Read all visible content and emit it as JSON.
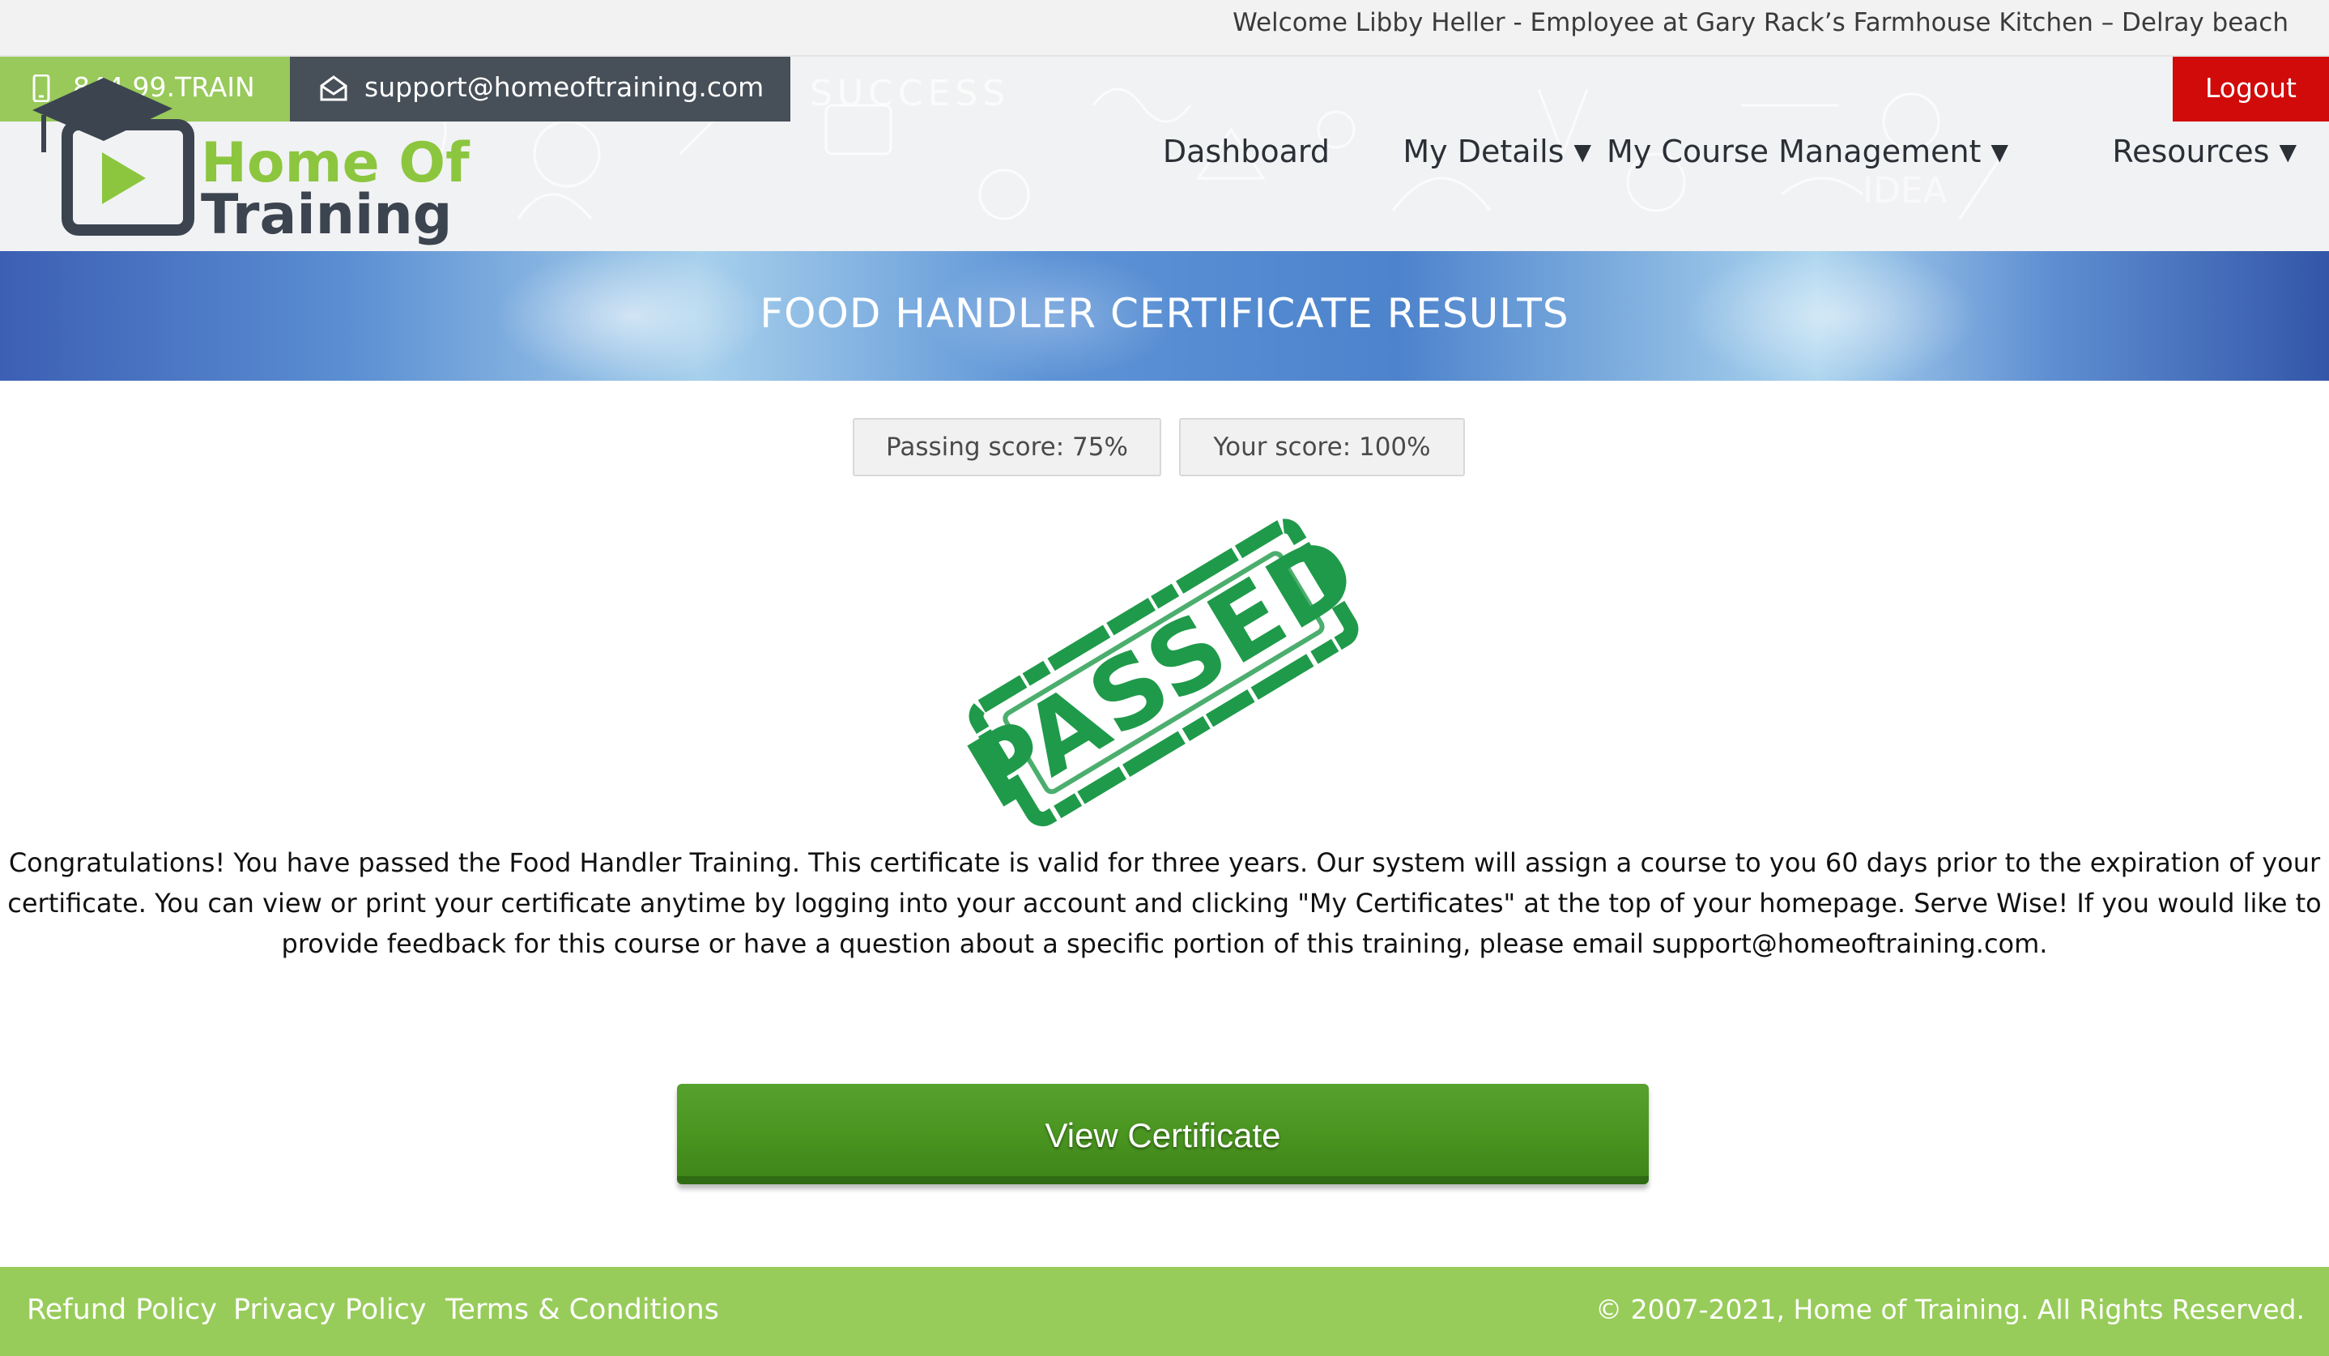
{
  "welcome": {
    "text": "Welcome Libby Heller - Employee at Gary Rack’s Farmhouse Kitchen – Delray beach"
  },
  "contact": {
    "phone": "844.99.TRAIN",
    "email": "support@homeoftraining.com",
    "phone_icon": "mobile-phone-icon",
    "email_icon": "envelope-icon"
  },
  "logout_label": "Logout",
  "logo": {
    "word1": "Home Of",
    "word2": "Training",
    "colors": {
      "green": "#8cc63f",
      "dark": "#3c4450"
    }
  },
  "nav": {
    "dashboard": "Dashboard",
    "my_details": "My Details",
    "course_management": "My Course Management",
    "resources": "Resources",
    "caret": "▼"
  },
  "banner": {
    "title": "FOOD HANDLER CERTIFICATE RESULTS"
  },
  "scores": {
    "passing": "Passing score: 75%",
    "yours": "Your score: 100%"
  },
  "stamp": {
    "text": "PASSED",
    "color": "#1f9a4a"
  },
  "message": "Congratulations! You have passed the Food Handler Training. This certificate is valid for three years. Our system will assign a course to you 60 days prior to the expiration of your certificate. You can view or print your certificate anytime by logging into your account and clicking \"My Certificates\" at the top of your homepage. Serve Wise! If you would like to provide feedback for this course or have a question about a specific portion of this training, please email support@homeoftraining.com.",
  "view_certificate_label": "View Certificate",
  "footer": {
    "refund": "Refund Policy",
    "privacy": "Privacy Policy",
    "terms": "Terms & Conditions",
    "copyright": "© 2007-2021, Home of Training. All Rights Reserved."
  },
  "colors": {
    "accent_green": "#98cc5a",
    "logout_red": "#d10a0a",
    "button_green": "#4a9520",
    "email_chip": "#474f59"
  }
}
